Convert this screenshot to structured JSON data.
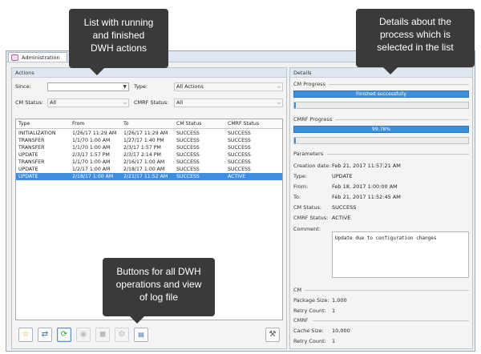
{
  "window": {
    "tab_title": "Administration"
  },
  "actions": {
    "panel_title": "Actions",
    "filters": {
      "since_label": "Since:",
      "since_value": "",
      "type_label": "Type:",
      "type_value": "All Actions",
      "cm_status_label": "CM Status:",
      "cm_status_value": "All",
      "cmrf_status_label": "CMRF Status:",
      "cmrf_status_value": "All"
    },
    "table": {
      "columns": [
        "Type",
        "From",
        "To",
        "CM Status",
        "CMRF Status"
      ],
      "rows": [
        [
          "INITIALIZATION",
          "1/26/17 11:29 AM",
          "1/26/17 11:29 AM",
          "SUCCESS",
          "SUCCESS"
        ],
        [
          "TRANSFER",
          "1/1/70 1:00 AM",
          "1/27/17 1:40 PM",
          "SUCCESS",
          "SUCCESS"
        ],
        [
          "TRANSFER",
          "1/1/70 1:00 AM",
          "2/3/17 1:57 PM",
          "SUCCESS",
          "SUCCESS"
        ],
        [
          "UPDATE",
          "2/3/17 1:57 PM",
          "2/3/17 2:14 PM",
          "SUCCESS",
          "SUCCESS"
        ],
        [
          "TRANSFER",
          "1/1/70 1:00 AM",
          "2/16/17 1:00 AM",
          "SUCCESS",
          "SUCCESS"
        ],
        [
          "UPDATE",
          "1/2/17 1:00 AM",
          "2/18/17 1:00 AM",
          "SUCCESS",
          "SUCCESS"
        ],
        [
          "UPDATE",
          "2/18/17 1:00 AM",
          "2/21/17 11:52 AM",
          "SUCCESS",
          "ACTIVE"
        ]
      ],
      "selected_row": 6
    },
    "toolbar": {
      "buttons": [
        "star-icon",
        "transfer-icon",
        "refresh-icon",
        "stop-icon",
        "pause-icon",
        "settings-icon",
        "log-file-icon",
        "tools-icon"
      ]
    }
  },
  "details": {
    "panel_title": "Details",
    "cm_progress_label": "CM Progress",
    "cm_progress_text": "Finished successfully",
    "cm_progress_fraction": 1.0,
    "cmrf_progress_label": "CMRF Progress",
    "cmrf_progress_text": "99.78%",
    "cmrf_progress_fraction": 0.9978,
    "parameters_label": "Parameters",
    "fields": [
      {
        "key": "Creation date:",
        "value": "Feb 21, 2017 11:57:21 AM"
      },
      {
        "key": "Type:",
        "value": "UPDATE"
      },
      {
        "key": "From:",
        "value": "Feb 18, 2017 1:00:00 AM"
      },
      {
        "key": "To:",
        "value": "Feb 21, 2017 11:52:45 AM"
      },
      {
        "key": "CM Status:",
        "value": "SUCCESS"
      },
      {
        "key": "CMRF Status:",
        "value": "ACTIVE"
      }
    ],
    "comment_label": "Comment:",
    "comment_value": "Update due to configuration changes",
    "cm_section_label": "CM",
    "cm_fields": [
      {
        "key": "Package Size:",
        "value": "1,000"
      },
      {
        "key": "Retry Count:",
        "value": "1"
      }
    ],
    "cmrf_section_label": "CMRF",
    "cmrf_fields": [
      {
        "key": "Cache Size:",
        "value": "10,000"
      },
      {
        "key": "Retry Count:",
        "value": "1"
      }
    ]
  },
  "callouts": {
    "list": [
      "List with running",
      "and finished",
      "DWH actions"
    ],
    "details": [
      "Details about the",
      "process which is",
      "selected in the list"
    ],
    "buttons": [
      "Buttons for all DWH",
      "operations and view",
      "of log file"
    ]
  }
}
